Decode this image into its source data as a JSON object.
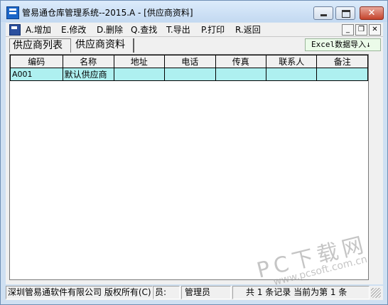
{
  "window": {
    "title": "管易通仓库管理系统--2015.A - [供应商资料]"
  },
  "menubar": {
    "items": [
      {
        "label": "A.增加"
      },
      {
        "label": "E.修改"
      },
      {
        "label": "D.删除"
      },
      {
        "label": "Q.查找"
      },
      {
        "label": "T.导出"
      },
      {
        "label": "P.打印"
      },
      {
        "label": "R.返回"
      }
    ]
  },
  "tabs": [
    {
      "label": "供应商列表",
      "active": true
    },
    {
      "label": "供应商资料",
      "active": false
    }
  ],
  "toolbar": {
    "excel_label": "Excel数据导入↓"
  },
  "grid": {
    "columns": [
      "编码",
      "名称",
      "地址",
      "电话",
      "传真",
      "联系人",
      "备注"
    ],
    "rows": [
      [
        "A001",
        "默认供应商",
        "",
        "",
        "",
        "",
        ""
      ]
    ]
  },
  "statusbar": {
    "company": "深圳管易通软件有限公司 版权所有(C)",
    "user_label": "员:",
    "user": "管理员",
    "record_count": "共 1 条记录",
    "current_record": "当前为第 1 条"
  },
  "watermark": {
    "text": "PC下载网",
    "url": "www.pcsoft.com.cn"
  },
  "colors": {
    "selected_row": "#aef0f0",
    "excel_button_bg": "#ebfbe9",
    "close_button": "#c4432c"
  }
}
